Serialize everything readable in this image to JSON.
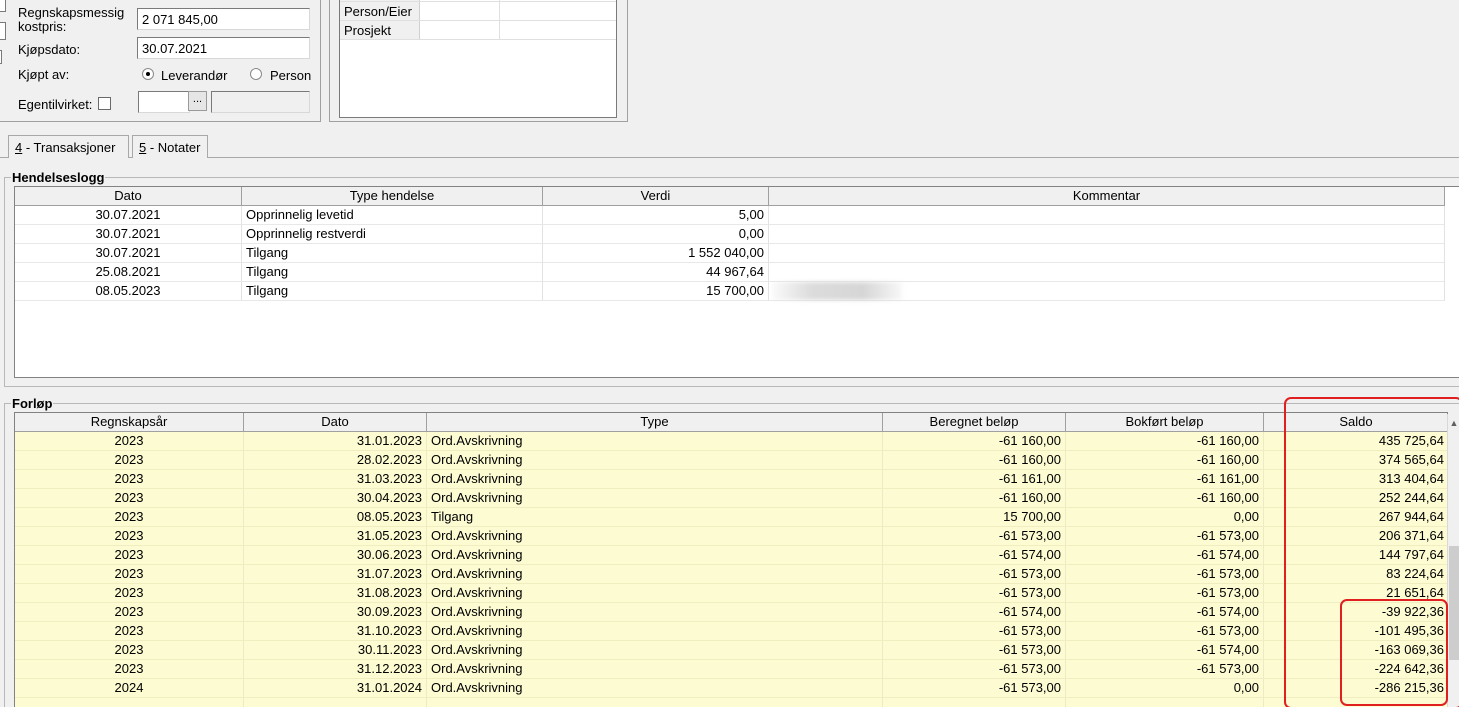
{
  "form": {
    "kostpris_label": "Regnskapsmessig kostpris:",
    "kostpris_value": "2 071 845,00",
    "kjopsdato_label": "Kjøpsdato:",
    "kjopsdato_value": "30.07.2021",
    "kjopt_av_label": "Kjøpt av:",
    "radio_leverandor": "Leverandør",
    "radio_person": "Person",
    "radio_selected": "Leverandør",
    "egentilvirket_label": "Egentilvirket:",
    "lookup_button": "..."
  },
  "dimensions": {
    "rows": [
      {
        "label": "Person/Eier"
      },
      {
        "label": "Prosjekt"
      }
    ]
  },
  "tabs": [
    {
      "key": "4",
      "label": " - Transaksjoner"
    },
    {
      "key": "5",
      "label": " - Notater"
    }
  ],
  "hendelseslogg": {
    "title": "Hendelseslogg",
    "columns": [
      "Dato",
      "Type hendelse",
      "Verdi",
      "Kommentar"
    ],
    "rows": [
      {
        "dato": "30.07.2021",
        "type": "Opprinnelig levetid",
        "verdi": "5,00"
      },
      {
        "dato": "30.07.2021",
        "type": "Opprinnelig restverdi",
        "verdi": "0,00"
      },
      {
        "dato": "30.07.2021",
        "type": "Tilgang",
        "verdi": "1 552 040,00"
      },
      {
        "dato": "25.08.2021",
        "type": "Tilgang",
        "verdi": "44 967,64"
      },
      {
        "dato": "08.05.2023",
        "type": "Tilgang",
        "verdi": "15 700,00"
      }
    ]
  },
  "forlop": {
    "title": "Forløp",
    "columns": [
      "Regnskapsår",
      "Dato",
      "Type",
      "Beregnet beløp",
      "Bokført beløp",
      "Saldo"
    ],
    "rows": [
      {
        "ar": "2023",
        "dato": "31.01.2023",
        "type": "Ord.Avskrivning",
        "beregnet": "-61 160,00",
        "bokfort": "-61 160,00",
        "saldo": "435 725,64"
      },
      {
        "ar": "2023",
        "dato": "28.02.2023",
        "type": "Ord.Avskrivning",
        "beregnet": "-61 160,00",
        "bokfort": "-61 160,00",
        "saldo": "374 565,64"
      },
      {
        "ar": "2023",
        "dato": "31.03.2023",
        "type": "Ord.Avskrivning",
        "beregnet": "-61 161,00",
        "bokfort": "-61 161,00",
        "saldo": "313 404,64"
      },
      {
        "ar": "2023",
        "dato": "30.04.2023",
        "type": "Ord.Avskrivning",
        "beregnet": "-61 160,00",
        "bokfort": "-61 160,00",
        "saldo": "252 244,64"
      },
      {
        "ar": "2023",
        "dato": "08.05.2023",
        "type": "Tilgang",
        "beregnet": "15 700,00",
        "bokfort": "0,00",
        "saldo": "267 944,64"
      },
      {
        "ar": "2023",
        "dato": "31.05.2023",
        "type": "Ord.Avskrivning",
        "beregnet": "-61 573,00",
        "bokfort": "-61 573,00",
        "saldo": "206 371,64"
      },
      {
        "ar": "2023",
        "dato": "30.06.2023",
        "type": "Ord.Avskrivning",
        "beregnet": "-61 574,00",
        "bokfort": "-61 574,00",
        "saldo": "144 797,64"
      },
      {
        "ar": "2023",
        "dato": "31.07.2023",
        "type": "Ord.Avskrivning",
        "beregnet": "-61 573,00",
        "bokfort": "-61 573,00",
        "saldo": "83 224,64"
      },
      {
        "ar": "2023",
        "dato": "31.08.2023",
        "type": "Ord.Avskrivning",
        "beregnet": "-61 573,00",
        "bokfort": "-61 573,00",
        "saldo": "21 651,64"
      },
      {
        "ar": "2023",
        "dato": "30.09.2023",
        "type": "Ord.Avskrivning",
        "beregnet": "-61 574,00",
        "bokfort": "-61 574,00",
        "saldo": "-39 922,36"
      },
      {
        "ar": "2023",
        "dato": "31.10.2023",
        "type": "Ord.Avskrivning",
        "beregnet": "-61 573,00",
        "bokfort": "-61 573,00",
        "saldo": "-101 495,36"
      },
      {
        "ar": "2023",
        "dato": "30.11.2023",
        "type": "Ord.Avskrivning",
        "beregnet": "-61 573,00",
        "bokfort": "-61 574,00",
        "saldo": "-163 069,36"
      },
      {
        "ar": "2023",
        "dato": "31.12.2023",
        "type": "Ord.Avskrivning",
        "beregnet": "-61 573,00",
        "bokfort": "-61 573,00",
        "saldo": "-224 642,36"
      },
      {
        "ar": "2024",
        "dato": "31.01.2024",
        "type": "Ord.Avskrivning",
        "beregnet": "-61 573,00",
        "bokfort": "0,00",
        "saldo": "-286 215,36"
      }
    ]
  },
  "colors": {
    "row_highlight": "#fdfbd2",
    "annotation": "#e02020"
  }
}
